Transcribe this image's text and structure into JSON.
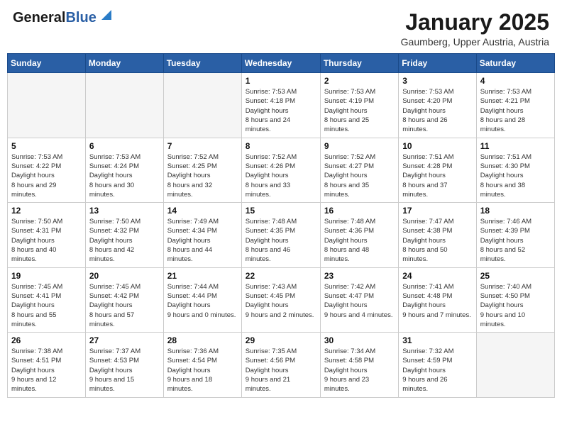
{
  "header": {
    "logo_general": "General",
    "logo_blue": "Blue",
    "month": "January 2025",
    "location": "Gaumberg, Upper Austria, Austria"
  },
  "weekdays": [
    "Sunday",
    "Monday",
    "Tuesday",
    "Wednesday",
    "Thursday",
    "Friday",
    "Saturday"
  ],
  "weeks": [
    [
      {
        "day": "",
        "empty": true
      },
      {
        "day": "",
        "empty": true
      },
      {
        "day": "",
        "empty": true
      },
      {
        "day": "1",
        "sunrise": "7:53 AM",
        "sunset": "4:18 PM",
        "daylight": "8 hours and 24 minutes."
      },
      {
        "day": "2",
        "sunrise": "7:53 AM",
        "sunset": "4:19 PM",
        "daylight": "8 hours and 25 minutes."
      },
      {
        "day": "3",
        "sunrise": "7:53 AM",
        "sunset": "4:20 PM",
        "daylight": "8 hours and 26 minutes."
      },
      {
        "day": "4",
        "sunrise": "7:53 AM",
        "sunset": "4:21 PM",
        "daylight": "8 hours and 28 minutes."
      }
    ],
    [
      {
        "day": "5",
        "sunrise": "7:53 AM",
        "sunset": "4:22 PM",
        "daylight": "8 hours and 29 minutes."
      },
      {
        "day": "6",
        "sunrise": "7:53 AM",
        "sunset": "4:24 PM",
        "daylight": "8 hours and 30 minutes."
      },
      {
        "day": "7",
        "sunrise": "7:52 AM",
        "sunset": "4:25 PM",
        "daylight": "8 hours and 32 minutes."
      },
      {
        "day": "8",
        "sunrise": "7:52 AM",
        "sunset": "4:26 PM",
        "daylight": "8 hours and 33 minutes."
      },
      {
        "day": "9",
        "sunrise": "7:52 AM",
        "sunset": "4:27 PM",
        "daylight": "8 hours and 35 minutes."
      },
      {
        "day": "10",
        "sunrise": "7:51 AM",
        "sunset": "4:28 PM",
        "daylight": "8 hours and 37 minutes."
      },
      {
        "day": "11",
        "sunrise": "7:51 AM",
        "sunset": "4:30 PM",
        "daylight": "8 hours and 38 minutes."
      }
    ],
    [
      {
        "day": "12",
        "sunrise": "7:50 AM",
        "sunset": "4:31 PM",
        "daylight": "8 hours and 40 minutes."
      },
      {
        "day": "13",
        "sunrise": "7:50 AM",
        "sunset": "4:32 PM",
        "daylight": "8 hours and 42 minutes."
      },
      {
        "day": "14",
        "sunrise": "7:49 AM",
        "sunset": "4:34 PM",
        "daylight": "8 hours and 44 minutes."
      },
      {
        "day": "15",
        "sunrise": "7:48 AM",
        "sunset": "4:35 PM",
        "daylight": "8 hours and 46 minutes."
      },
      {
        "day": "16",
        "sunrise": "7:48 AM",
        "sunset": "4:36 PM",
        "daylight": "8 hours and 48 minutes."
      },
      {
        "day": "17",
        "sunrise": "7:47 AM",
        "sunset": "4:38 PM",
        "daylight": "8 hours and 50 minutes."
      },
      {
        "day": "18",
        "sunrise": "7:46 AM",
        "sunset": "4:39 PM",
        "daylight": "8 hours and 52 minutes."
      }
    ],
    [
      {
        "day": "19",
        "sunrise": "7:45 AM",
        "sunset": "4:41 PM",
        "daylight": "8 hours and 55 minutes."
      },
      {
        "day": "20",
        "sunrise": "7:45 AM",
        "sunset": "4:42 PM",
        "daylight": "8 hours and 57 minutes."
      },
      {
        "day": "21",
        "sunrise": "7:44 AM",
        "sunset": "4:44 PM",
        "daylight": "9 hours and 0 minutes."
      },
      {
        "day": "22",
        "sunrise": "7:43 AM",
        "sunset": "4:45 PM",
        "daylight": "9 hours and 2 minutes."
      },
      {
        "day": "23",
        "sunrise": "7:42 AM",
        "sunset": "4:47 PM",
        "daylight": "9 hours and 4 minutes."
      },
      {
        "day": "24",
        "sunrise": "7:41 AM",
        "sunset": "4:48 PM",
        "daylight": "9 hours and 7 minutes."
      },
      {
        "day": "25",
        "sunrise": "7:40 AM",
        "sunset": "4:50 PM",
        "daylight": "9 hours and 10 minutes."
      }
    ],
    [
      {
        "day": "26",
        "sunrise": "7:38 AM",
        "sunset": "4:51 PM",
        "daylight": "9 hours and 12 minutes."
      },
      {
        "day": "27",
        "sunrise": "7:37 AM",
        "sunset": "4:53 PM",
        "daylight": "9 hours and 15 minutes."
      },
      {
        "day": "28",
        "sunrise": "7:36 AM",
        "sunset": "4:54 PM",
        "daylight": "9 hours and 18 minutes."
      },
      {
        "day": "29",
        "sunrise": "7:35 AM",
        "sunset": "4:56 PM",
        "daylight": "9 hours and 21 minutes."
      },
      {
        "day": "30",
        "sunrise": "7:34 AM",
        "sunset": "4:58 PM",
        "daylight": "9 hours and 23 minutes."
      },
      {
        "day": "31",
        "sunrise": "7:32 AM",
        "sunset": "4:59 PM",
        "daylight": "9 hours and 26 minutes."
      },
      {
        "day": "",
        "empty": true
      }
    ]
  ],
  "labels": {
    "sunrise": "Sunrise:",
    "sunset": "Sunset:",
    "daylight": "Daylight hours"
  }
}
